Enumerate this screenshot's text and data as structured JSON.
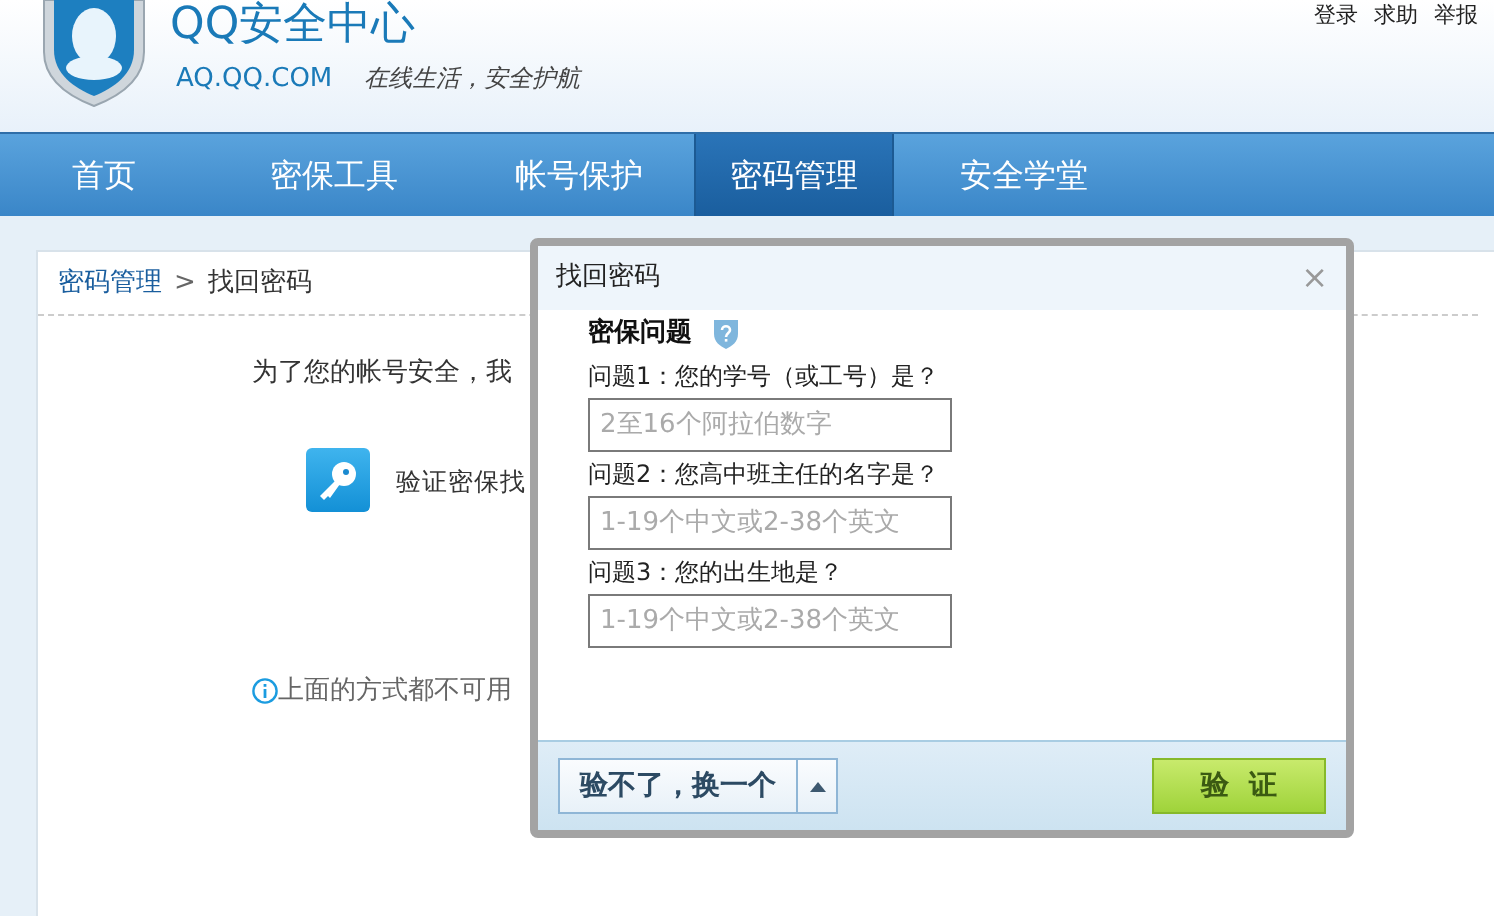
{
  "header": {
    "logo_title": "QQ安全中心",
    "domain": "AQ.QQ.COM",
    "slogan": "在线生活，安全护航",
    "top_links": [
      "登录",
      "求助",
      "举报"
    ]
  },
  "nav": [
    {
      "label": "首页",
      "selected": false
    },
    {
      "label": "密保工具",
      "selected": false
    },
    {
      "label": "帐号保护",
      "selected": false
    },
    {
      "label": "密码管理",
      "selected": true
    },
    {
      "label": "安全学堂",
      "selected": false
    }
  ],
  "breadcrumb": {
    "parent": "密码管理",
    "separator": ">",
    "current": "找回密码"
  },
  "page": {
    "intro": "为了您的帐号安全，我",
    "method": "验证密保找",
    "fallback": "上面的方式都不可用"
  },
  "dialog": {
    "title": "找回密码",
    "close": "×",
    "section_title": "密保问题",
    "questions": [
      {
        "label": "问题1：您的学号（或工号）是？",
        "placeholder": "2至16个阿拉伯数字"
      },
      {
        "label": "问题2：您高中班主任的名字是？",
        "placeholder": "1-19个中文或2-38个英文"
      },
      {
        "label": "问题3：您的出生地是？",
        "placeholder": "1-19个中文或2-38个英文"
      }
    ],
    "switch_button": "验不了，换一个",
    "verify_button": "验  证"
  }
}
